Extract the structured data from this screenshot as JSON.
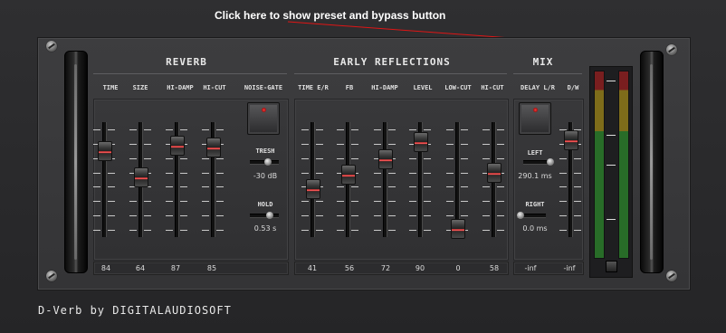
{
  "hint": {
    "text": "Click here to show preset and bypass button"
  },
  "sections": {
    "reverb": "REVERB",
    "early": "EARLY REFLECTIONS",
    "mix": "MIX"
  },
  "reverb_labels": [
    "TIME",
    "SIZE",
    "HI-DAMP",
    "HI-CUT",
    "NOISE-GATE"
  ],
  "reverb_values": [
    "84",
    "64",
    "87",
    "85"
  ],
  "reverb_levels": [
    0.8,
    0.53,
    0.86,
    0.84
  ],
  "noise_gate": {
    "tresh_label": "TRESH",
    "tresh_value": "-30 dB",
    "hold_label": "HOLD",
    "hold_value": "0.53 s"
  },
  "early_labels": [
    "TIME E/R",
    "FB",
    "HI-DAMP",
    "LEVEL",
    "LOW-CUT",
    "HI-CUT"
  ],
  "early_values": [
    "41",
    "56",
    "72",
    "90",
    "0",
    "58"
  ],
  "early_levels": [
    0.41,
    0.56,
    0.72,
    0.9,
    0.0,
    0.58
  ],
  "mix_labels": [
    "DELAY L/R",
    "D/W"
  ],
  "mix": {
    "left_label": "LEFT",
    "left_value": "290.1 ms",
    "right_label": "RIGHT",
    "right_value": "0.0 ms"
  },
  "mix_values": [
    "-inf",
    "-inf"
  ],
  "footer": "D-Verb  by  DIGITALAUDIOSOFT"
}
